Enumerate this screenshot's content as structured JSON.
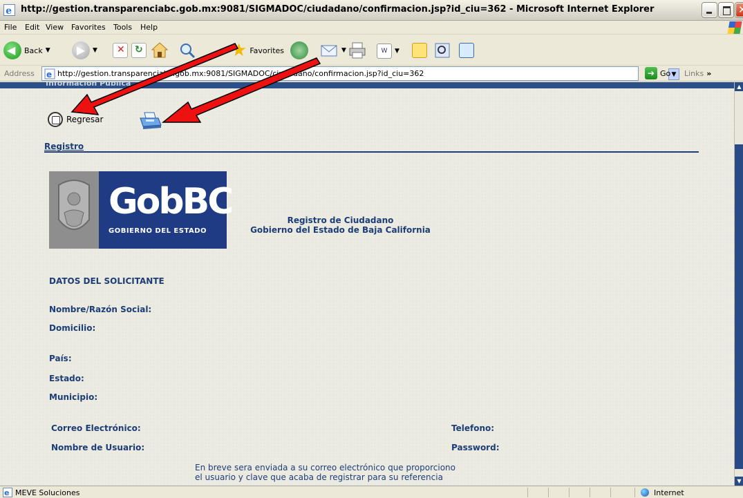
{
  "window": {
    "title": "http://gestion.transparenciabc.gob.mx:9081/SIGMADOC/ciudadano/confirmacion.jsp?id_ciu=362 - Microsoft Internet Explorer"
  },
  "menu": [
    "File",
    "Edit",
    "View",
    "Favorites",
    "Tools",
    "Help"
  ],
  "toolbar": {
    "back_label": "Back",
    "favorites_label": "Favorites"
  },
  "address": {
    "label": "Address",
    "url": "http://gestion.transparenciabc.gob.mx:9081/SIGMADOC/ciudadano/confirmacion.jsp?id_ciu=362",
    "go_label": "Go",
    "links_label": "Links"
  },
  "page": {
    "top_strip_text": "Información Pública",
    "regresar_label": "Regresar",
    "section_header": "Registro",
    "logo": {
      "brand": "GobBC",
      "subtitle": "GOBIERNO DEL ESTADO"
    },
    "title_line1": "Registro de Ciudadano",
    "title_line2": "Gobierno del Estado de Baja California",
    "datos_header": "DATOS DEL SOLICITANTE",
    "fields": {
      "nombre": "Nombre/Razón Social:",
      "domicilio": "Domicilio:",
      "pais": "País:",
      "estado": "Estado:",
      "municipio": "Municipio:",
      "correo": "Correo Electrónico:",
      "telefono": "Telefono:",
      "usuario": "Nombre de Usuario:",
      "password": "Password:"
    },
    "notice_line1": "En breve sera enviada a su correo electrónico que proporciono",
    "notice_line2": "el usuario y clave que acaba de registrar para su referencia"
  },
  "status": {
    "text": "MEVE Soluciones",
    "zone": "Internet"
  },
  "colors": {
    "accent_blue": "#1c3d78",
    "arrow_red": "#ee1111"
  },
  "icons": [
    "ie-icon",
    "back-icon",
    "forward-icon",
    "stop-icon",
    "refresh-icon",
    "home-icon",
    "search-icon",
    "favorites-star-icon",
    "history-icon",
    "mail-icon",
    "print-icon",
    "edit-icon",
    "messenger-icon",
    "regresar-icon",
    "printer-icon"
  ]
}
